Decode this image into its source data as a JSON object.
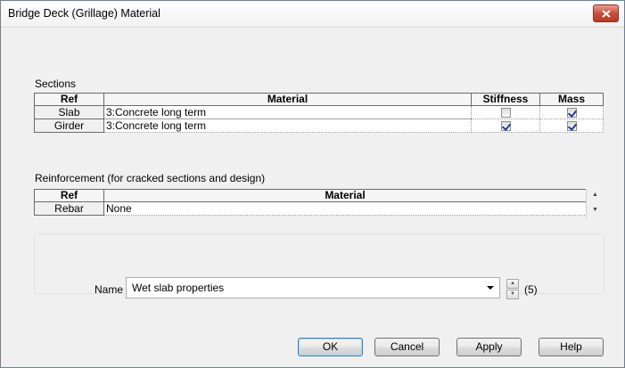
{
  "window": {
    "title": "Bridge Deck (Grillage) Material"
  },
  "sections": {
    "label": "Sections",
    "columns": [
      "Ref",
      "Material",
      "Stiffness",
      "Mass"
    ],
    "rows": [
      {
        "ref": "Slab",
        "material": "3:Concrete long term",
        "stiffness": false,
        "mass": true
      },
      {
        "ref": "Girder",
        "material": "3:Concrete long term",
        "stiffness": true,
        "mass": true
      }
    ]
  },
  "reinforcement": {
    "label": "Reinforcement (for cracked sections and design)",
    "columns": [
      "Ref",
      "Material"
    ],
    "rows": [
      {
        "ref": "Rebar",
        "material": "None"
      }
    ]
  },
  "name": {
    "label": "Name",
    "value": "Wet slab properties",
    "count": "(5)"
  },
  "buttons": {
    "ok": "OK",
    "cancel": "Cancel",
    "apply": "Apply",
    "help": "Help"
  }
}
